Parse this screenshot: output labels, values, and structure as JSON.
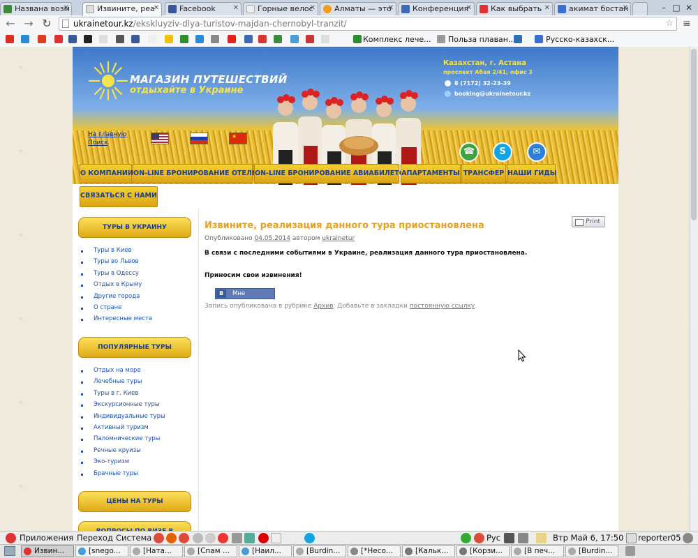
{
  "browser": {
    "tabs": [
      {
        "label": "Названа возм",
        "color": "#3c8a3c"
      },
      {
        "label": "Извините, реа",
        "color": "#cccccc",
        "active": true
      },
      {
        "label": "Facebook",
        "color": "#3b5998"
      },
      {
        "label": "Горные велос",
        "color": "#dddddd"
      },
      {
        "label": "Алматы — это",
        "color": "#f19a1b"
      },
      {
        "label": "Конференция",
        "color": "#3d6bb3"
      },
      {
        "label": "Как выбрать",
        "color": "#d33"
      },
      {
        "label": "акимат бостан",
        "color": "#3b6fcf"
      }
    ],
    "url_host": "ukrainetour.kz",
    "url_path": "/ekskluyziv-dlya-turistov-majdan-chernobyl-tranzit/",
    "bookmarks": [
      {
        "icon": "gmail-icon",
        "color": "#d93025"
      },
      {
        "icon": "bookmark-icon-2",
        "color": "#2c8bd6"
      },
      {
        "icon": "bookmark-icon-3",
        "color": "#e03c1f"
      },
      {
        "icon": "bookmark-icon-4",
        "color": "#d33"
      },
      {
        "icon": "facebook-icon",
        "color": "#3b5998"
      },
      {
        "icon": "bookmark-icon-6",
        "color": "#222"
      },
      {
        "icon": "bookmark-icon-7",
        "color": "#ddd"
      },
      {
        "icon": "bookmark-icon-8",
        "color": "#555"
      },
      {
        "icon": "bookmark-icon-9",
        "color": "#3b5998"
      },
      {
        "icon": "bookmark-icon-10",
        "color": "#eee"
      },
      {
        "icon": "bookmark-icon-11",
        "color": "#f2c200"
      },
      {
        "icon": "bookmark-icon-12",
        "color": "#2f8f2f"
      },
      {
        "icon": "bookmark-icon-13",
        "color": "#2c8bd6"
      },
      {
        "icon": "bookmark-icon-14",
        "color": "#888"
      },
      {
        "icon": "youtube-icon",
        "color": "#e62117"
      },
      {
        "icon": "bookmark-icon-16",
        "color": "#3d6bb3"
      },
      {
        "icon": "bookmark-icon-17",
        "color": "#d33"
      },
      {
        "icon": "bookmark-icon-18",
        "color": "#3c8a3c"
      },
      {
        "icon": "bookmark-icon-19",
        "color": "#4a9cd4"
      },
      {
        "icon": "bookmark-icon-20",
        "color": "#c33"
      },
      {
        "icon": "bookmark-icon-21",
        "color": "#ddd"
      }
    ],
    "bookmark_links": [
      {
        "label": "Комплекс лече...",
        "color": "#2f8f2f"
      },
      {
        "label": "Польза плаван...",
        "color": "#999999"
      },
      {
        "label": "",
        "color": "#2c6fb1"
      },
      {
        "label": "Русско-казахск...",
        "color": "#3b6fcf"
      }
    ]
  },
  "site": {
    "logo_title": "МАГАЗИН ПУТЕШЕСТВИЙ",
    "logo_sub": "отдыхайте в Украине",
    "contact_city": "Казахстан, г. Астана",
    "contact_addr": "проспект Абая 2/41, офис 3",
    "contact_phone": "8 (7172) 32-23-39",
    "contact_email": "booking@ukrainetour.kz",
    "link_home": "На главную",
    "link_search": "Поиск",
    "nav": [
      "О КОМПАНИИ",
      "ON-LINE БРОНИРОВАНИЕ ОТЕЛЕЙ",
      "ON-LINE БРОНИРОВАНИЕ АВИАБИЛЕТОВ",
      "АПАРТАМЕНТЫ",
      "ТРАНСФЕР",
      "НАШИ ГИДЫ"
    ],
    "nav_contact": "СВЯЗАТЬСЯ С НАМИ",
    "sidebar": {
      "sec1_title": "ТУРЫ В УКРАИНУ",
      "sec1_items": [
        "Туры в Киев",
        "Туры во Львов",
        "Туры в Одессу",
        "Отдых в Крыму",
        "Другие города",
        "О стране",
        "Интересные места"
      ],
      "sec2_title": "ПОПУЛЯРНЫЕ ТУРЫ",
      "sec2_items": [
        "Отдых на море",
        "Лечебные туры",
        "Туры в г. Киев",
        "Экскурсионные туры",
        "Индивидуальные туры",
        "Активный туризм",
        "Паломнические туры",
        "Речные круизы",
        "Эко-туризм",
        "Брачные туры"
      ],
      "sec3_title": "ЦЕНЫ НА ТУРЫ",
      "sec4_title": "ВОПРОСЫ ПО ВИЗЕ В УКРАИНУ"
    },
    "post": {
      "title": "Извините, реализация данного тура приостановлена",
      "meta_prefix": "Опубликовано",
      "meta_date": "04.05.2014",
      "meta_mid": "автором",
      "meta_author": "ukrainetur",
      "p1": "В связи с последними событиями в Украине, реализация данного тура приостановлена.",
      "p2": "Приносим свои извинения!",
      "like_label": "Мне нравится",
      "like_icon_text": "B",
      "footer_prefix": "Запись опубликована в рубрике",
      "footer_cat": "Архив",
      "footer_mid": ". Добавьте в закладки",
      "footer_link": "постоянную ссылку",
      "footer_end": ".",
      "print_label": "Print"
    }
  },
  "desktop": {
    "menu": [
      "Приложения",
      "Переход",
      "Система"
    ],
    "lang": "Рус",
    "clock": "Втр Май  6, 17:50",
    "user": "reporter05",
    "tasks": [
      {
        "label": "Извин...",
        "active": true,
        "color": "#d33"
      },
      {
        "label": "[snego...",
        "color": "#4a9cd4"
      },
      {
        "label": "[Ната...",
        "color": "#aaa"
      },
      {
        "label": "[Спам ...",
        "color": "#aaa"
      },
      {
        "label": "[Наил...",
        "color": "#4a9cd4"
      },
      {
        "label": "[Burdin...",
        "color": "#aaa"
      },
      {
        "label": "[*Несо...",
        "color": "#888"
      },
      {
        "label": "[Кальк...",
        "color": "#777"
      },
      {
        "label": "[Корзи...",
        "color": "#777"
      },
      {
        "label": "[В печ...",
        "color": "#aaa"
      },
      {
        "label": "[Burdin...",
        "color": "#aaa"
      }
    ]
  },
  "colors": {
    "accent_yellow": "#f7e34a",
    "nav_text": "#1c3e8c",
    "post_title": "#e3a126"
  }
}
